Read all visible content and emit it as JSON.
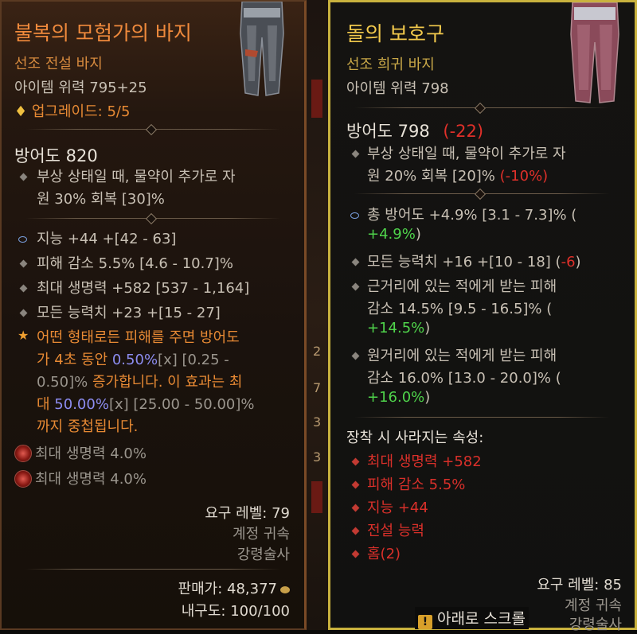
{
  "left": {
    "title": "불복의 모험가의 바지",
    "subtype": "선조 전설 바지",
    "item_power": "아이템 위력 795+25",
    "upgrade": "업그레이드: 5/5",
    "armor": "방어도 820",
    "implicit": [
      "부상 상태일 때, 물약이 추가로 자",
      "원 30% 회복 [30]%"
    ],
    "affixes": [
      "지능 +44 +[42 - 63]",
      "피해 감소 5.5% [4.6 - 10.7]%",
      "최대 생명력 +582 [537 - 1,164]",
      "모든 능력치 +23 +[15 - 27]"
    ],
    "legendary": {
      "line1": "어떤 형태로든 피해를 주면 방어도",
      "line2_a": "가 4초 동안 ",
      "line2_b": "0.50%",
      "line2_c": "[x] [0.25 -",
      "line3_a": "0.50]%",
      "line3_b": " 증가합니다. 이 효과는 최",
      "line4_a": "대 ",
      "line4_b": "50.00%",
      "line4_c": "[x] [25.00 - 50.00]%",
      "line5": "까지 중첩됩니다."
    },
    "sockets": [
      "최대 생명력 4.0%",
      "최대 생명력 4.0%"
    ],
    "req_level": "요구 레벨: 79",
    "account_bound": "계정 귀속",
    "class": "강령술사",
    "sell_price": "판매가: 48,377",
    "durability": "내구도: 100/100"
  },
  "middle": {
    "digits": [
      "2",
      "7",
      "3",
      "3"
    ]
  },
  "right": {
    "title": "돌의 보호구",
    "subtype": "선조 희귀 바지",
    "item_power": "아이템 위력 798",
    "armor": "방어도 798",
    "armor_diff": "(-22)",
    "implicit_1": "부상 상태일 때, 물약이 추가로 자",
    "implicit_2a": "원 20% 회복 [20]% ",
    "implicit_2b": "(-10%)",
    "affix1_a": "총 방어도 +4.9% [3.1 - 7.3]% (",
    "affix1_b": "+4.9%",
    "affix1_c": ")",
    "affix2_a": "모든 능력치 +16 +[10 - 18] (",
    "affix2_b": "-6",
    "affix2_c": ")",
    "affix3_1": "근거리에 있는 적에게 받는 피해",
    "affix3_2": "감소 14.5% [9.5 - 16.5]% (",
    "affix3_3a": "+14.5%",
    "affix3_3b": ")",
    "affix4_1": "원거리에 있는 적에게 받는 피해",
    "affix4_2": "감소 16.0% [13.0 - 20.0]% (",
    "affix4_3a": "+16.0%",
    "affix4_3b": ")",
    "lost_header": "장착 시 사라지는 속성:",
    "lost": [
      "최대 생명력 +582",
      "피해 감소 5.5%",
      "지능 +44",
      "전설 능력",
      "홈(2)"
    ],
    "req_level": "요구 레벨: 85",
    "account_bound": "계정 귀속",
    "class": "강령술사",
    "scroll_hint": "아래로 스크롤"
  },
  "colors": {
    "legendary_orange": "#f08a3c",
    "rare_yellow": "#f2c94c",
    "border_gold": "#c9b23e",
    "negative_red": "#e0302a",
    "positive_green": "#4fd44b"
  },
  "icons": [
    "diamond-bullet-icon",
    "ring-bullet-icon",
    "star-bullet-icon",
    "ruby-socket-icon",
    "gold-coin-icon",
    "scroll-warning-icon"
  ]
}
